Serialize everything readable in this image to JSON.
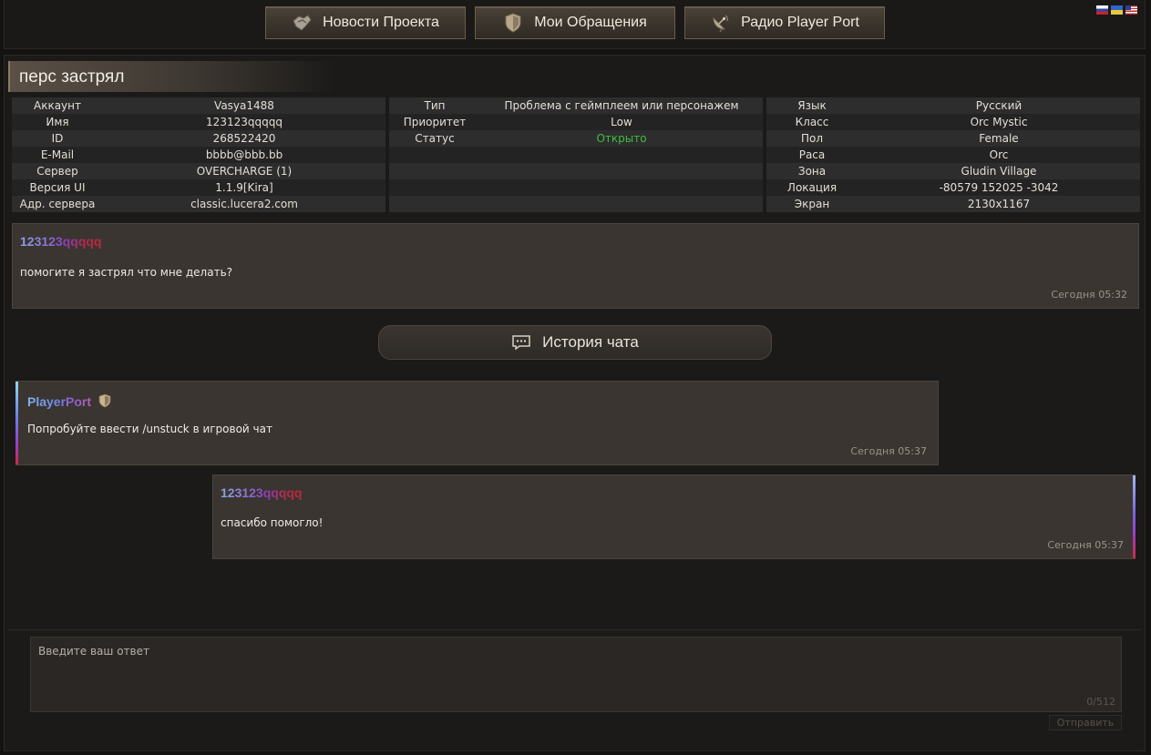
{
  "nav": {
    "news_label": "Новости Проекта",
    "news_icon": "handshake-icon",
    "tickets_label": "Мои Обращения",
    "tickets_icon": "shield-icon",
    "radio_label": "Радио Player Port",
    "radio_icon": "satellite-dish-icon",
    "languages": [
      "ru",
      "ua",
      "us"
    ]
  },
  "ticket": {
    "title": "перс застрял",
    "info": {
      "col1": [
        {
          "k": "Аккаунт",
          "v": "Vasya1488"
        },
        {
          "k": "Имя",
          "v": "123123qqqqq"
        },
        {
          "k": "ID",
          "v": "268522420"
        },
        {
          "k": "E-Mail",
          "v": "bbbb@bbb.bb"
        },
        {
          "k": "Сервер",
          "v": "OVERCHARGE (1)"
        },
        {
          "k": "Версия UI",
          "v": "1.1.9[Kira]"
        },
        {
          "k": "Адр. сервера",
          "v": "classic.lucera2.com"
        }
      ],
      "col2": [
        {
          "k": "Тип",
          "v": "Проблема с геймплеем или персонажем"
        },
        {
          "k": "Приоритет",
          "v": "Low"
        },
        {
          "k": "Статус",
          "v": "Открыто"
        }
      ],
      "col3": [
        {
          "k": "Язык",
          "v": "Русский"
        },
        {
          "k": "Класс",
          "v": "Orc Mystic"
        },
        {
          "k": "Пол",
          "v": "Female"
        },
        {
          "k": "Раса",
          "v": "Orc"
        },
        {
          "k": "Зона",
          "v": "Gludin Village"
        },
        {
          "k": "Локация",
          "v": "-80579 152025 -3042"
        },
        {
          "k": "Экран",
          "v": "2130x1167"
        }
      ]
    },
    "status_color": "#3fbf3f"
  },
  "messages": {
    "original": {
      "author": "123123qqqqq",
      "text": "помогите я застрял что мне делать?",
      "time": "Сегодня 05:32"
    },
    "history_label": "История чата",
    "staff": {
      "author": "PlayerPort",
      "text": "Попробуйте ввести /unstuck в игровой чат",
      "time": "Сегодня 05:37"
    },
    "user_reply": {
      "author": "123123qqqqq",
      "text": "спасибо помогло!",
      "time": "Сегодня 05:37"
    }
  },
  "reply": {
    "placeholder": "Введите ваш ответ",
    "counter": "0/512",
    "send_label": "Отправить"
  }
}
